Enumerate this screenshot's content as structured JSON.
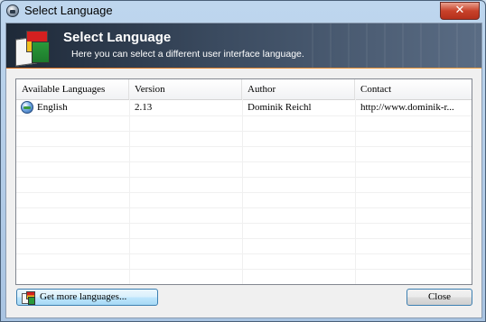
{
  "window": {
    "title": "Select Language",
    "close_glyph": "✕"
  },
  "banner": {
    "title": "Select Language",
    "subtitle": "Here you can select a different user interface language."
  },
  "list": {
    "columns": [
      "Available Languages",
      "Version",
      "Author",
      "Contact"
    ],
    "rows": [
      {
        "icon": "globe-icon",
        "language": "English",
        "version": "2.13",
        "author": "Dominik Reichl",
        "contact": "http://www.dominik-r..."
      }
    ]
  },
  "buttons": {
    "more_languages": "Get more languages...",
    "close": "Close"
  },
  "colors": {
    "banner_dark": "#1e2938",
    "banner_accent": "#d46a1a",
    "title_close": "#c8422a"
  }
}
